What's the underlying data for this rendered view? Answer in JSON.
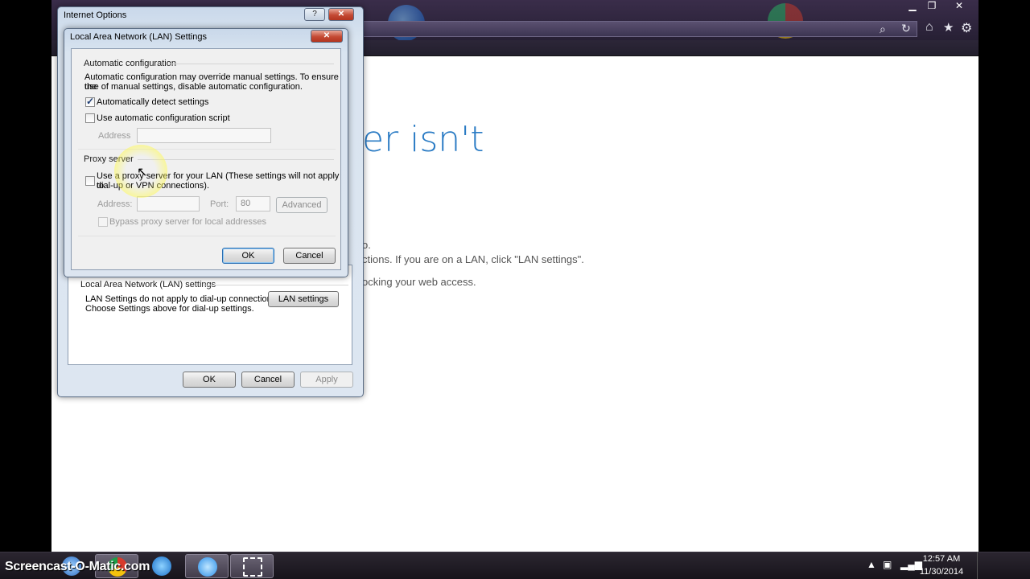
{
  "browser": {
    "heading": "er isn't",
    "line1": "o.",
    "line2": "ctions. If you are on a LAN, click \"LAN settings\".",
    "line3": "ocking your web access."
  },
  "internet_options": {
    "title": "Internet Options",
    "help_glyph": "?",
    "close_glyph": "✕",
    "lan_section_label": "Local Area Network (LAN) settings",
    "lan_note_line1": "LAN Settings do not apply to dial-up connections.",
    "lan_note_line2": "Choose Settings above for dial-up settings.",
    "lan_settings_button": "LAN settings",
    "ok": "OK",
    "cancel": "Cancel",
    "apply": "Apply"
  },
  "lan_dialog": {
    "title": "Local Area Network (LAN) Settings",
    "close_glyph": "✕",
    "auto_config_label": "Automatic configuration",
    "auto_config_desc1": "Automatic configuration may override manual settings.  To ensure the",
    "auto_config_desc2": "use of manual settings, disable automatic configuration.",
    "auto_detect_label": "Automatically detect settings",
    "auto_detect_checked": true,
    "use_script_label": "Use automatic configuration script",
    "use_script_checked": false,
    "address_label": "Address",
    "proxy_label": "Proxy server",
    "use_proxy_line1": "Use a proxy server for your LAN (These settings will not apply to",
    "use_proxy_line2": "dial-up or VPN connections).",
    "use_proxy_checked": false,
    "proxy_address_label": "Address:",
    "port_label": "Port:",
    "port_value": "80",
    "advanced_button": "Advanced",
    "bypass_label": "Bypass proxy server for local addresses",
    "bypass_checked": false,
    "ok": "OK",
    "cancel": "Cancel"
  },
  "taskbar": {
    "watermark": "Screencast-O-Matic.com",
    "time": "12:57 AM",
    "date": "11/30/2014"
  }
}
